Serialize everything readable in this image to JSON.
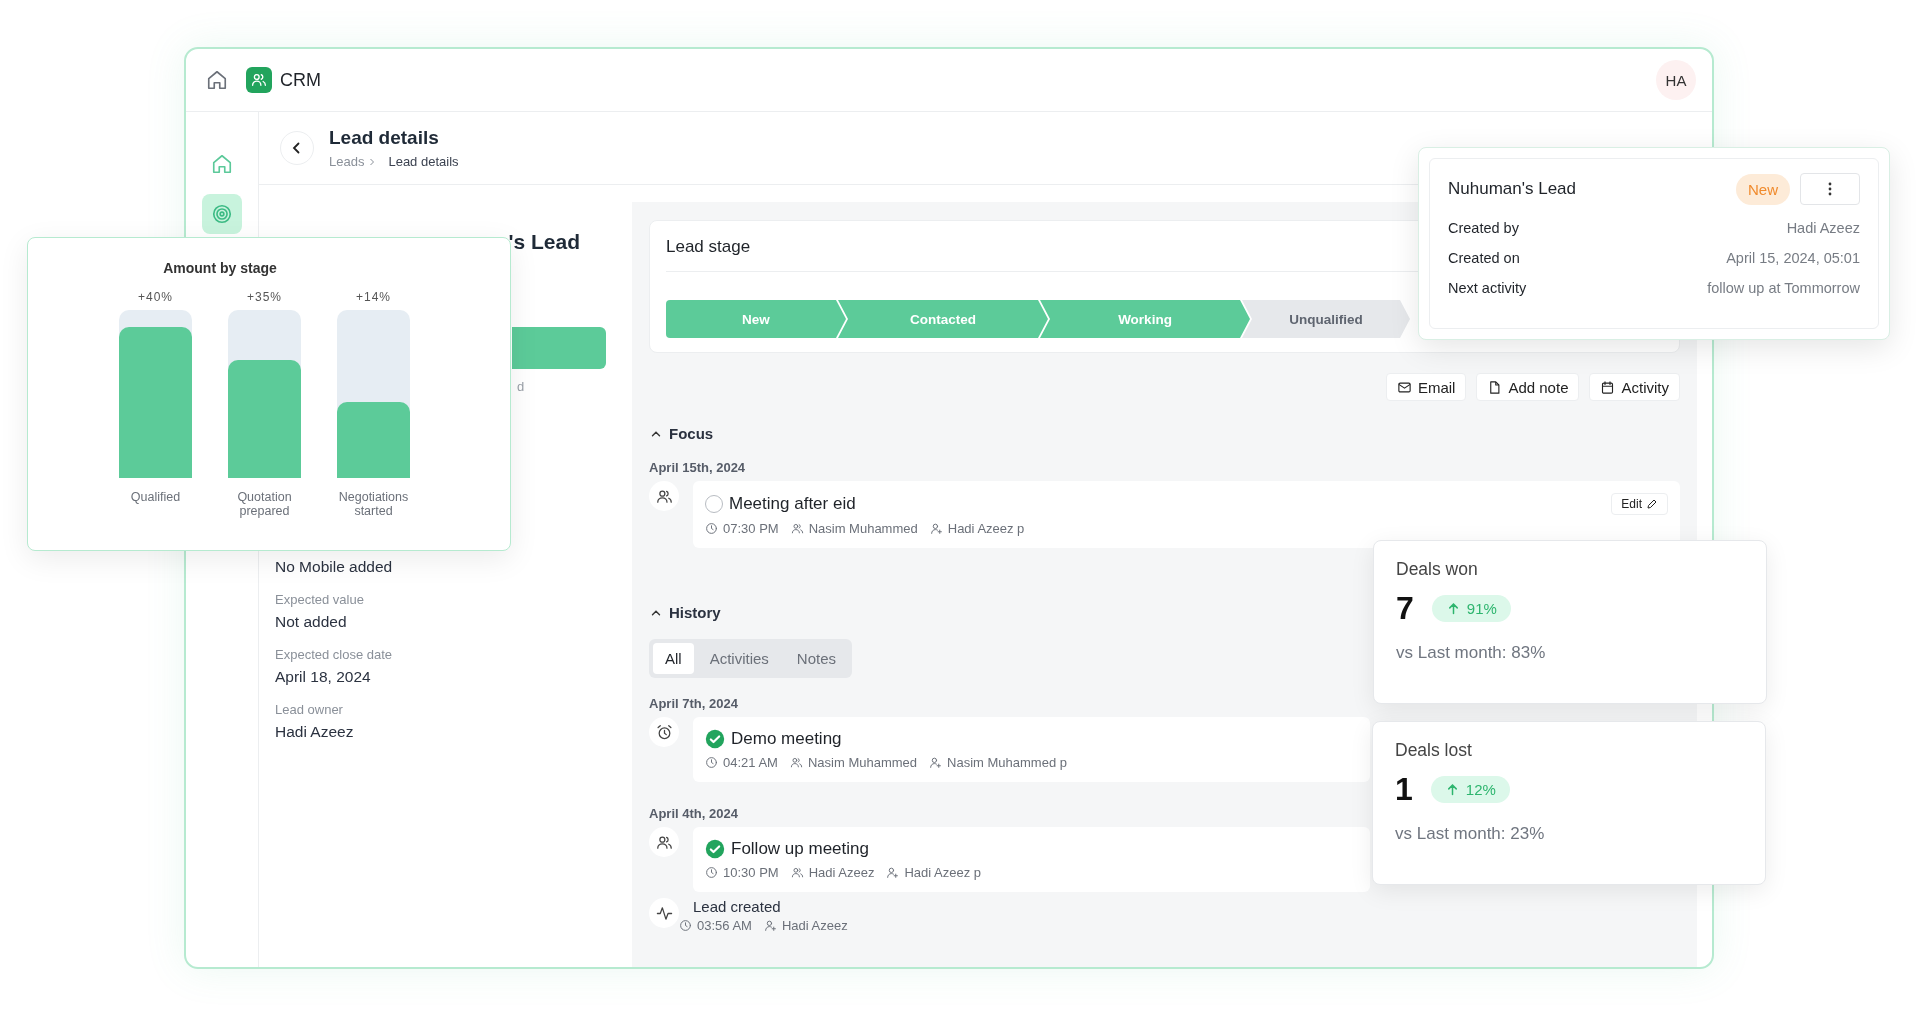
{
  "app": {
    "name": "CRM",
    "avatar": "HA"
  },
  "sidebar": {
    "items": [
      {
        "kind": "home",
        "selected": false
      },
      {
        "kind": "leads",
        "selected": true
      }
    ]
  },
  "page": {
    "title": "Lead details",
    "breadcrumb": [
      "Leads",
      "Lead details"
    ]
  },
  "lead_panel": {
    "heading": "'s Lead",
    "fragment": "d",
    "fields": [
      {
        "value": "No Mobile added"
      },
      {
        "label": "Expected value",
        "value": "Not added"
      },
      {
        "label": "Expected close date",
        "value": "April 18, 2024"
      },
      {
        "label": "Lead owner",
        "value": "Hadi Azeez"
      }
    ]
  },
  "lead_stage": {
    "title": "Lead stage",
    "stages": [
      {
        "label": "New",
        "done": true
      },
      {
        "label": "Contacted",
        "done": true
      },
      {
        "label": "Working",
        "done": true
      },
      {
        "label": "Unqualified",
        "done": false
      }
    ]
  },
  "actions": [
    {
      "kind": "email",
      "label": "Email"
    },
    {
      "kind": "note",
      "label": "Add note"
    },
    {
      "kind": "calendar",
      "label": "Activity"
    }
  ],
  "focus": {
    "title": "Focus",
    "expanded": true,
    "groups": [
      {
        "date": "April 15th, 2024",
        "items": [
          {
            "kind": "meeting",
            "title": "Meeting after eid",
            "done": false,
            "time": "07:30 PM",
            "attendee": "Nasim Muhammed",
            "owner": "Hadi Azeez p",
            "edit": "Edit"
          }
        ]
      }
    ]
  },
  "history": {
    "title": "History",
    "expanded": true,
    "tabs": [
      {
        "label": "All",
        "selected": true
      },
      {
        "label": "Activities",
        "selected": false
      },
      {
        "label": "Notes",
        "selected": false
      }
    ],
    "groups": [
      {
        "date": "April 7th, 2024",
        "items": [
          {
            "kind": "reminder",
            "title": "Demo meeting",
            "done": true,
            "time": "04:21 AM",
            "attendee": "Nasim Muhammed",
            "owner": "Nasim Muhammed p"
          }
        ]
      },
      {
        "date": "April 4th, 2024",
        "items": [
          {
            "kind": "meeting",
            "title": "Follow up meeting",
            "done": true,
            "time": "10:30 PM",
            "attendee": "Hadi Azeez",
            "owner": "Hadi Azeez p"
          },
          {
            "kind": "created",
            "title": "Lead created",
            "time": "03:56 AM",
            "owner": "Hadi Azeez"
          }
        ]
      }
    ]
  },
  "stage_chart": {
    "title": "Amount by stage",
    "bars": [
      {
        "label": "Qualified",
        "change": "+40%",
        "level": 0.9
      },
      {
        "label": "Quotation prepared",
        "change": "+35%",
        "level": 0.7
      },
      {
        "label": "Negotiations started",
        "change": "+14%",
        "level": 0.45
      }
    ]
  },
  "lead_card": {
    "title": "Nuhuman's Lead",
    "status": "New",
    "rows": [
      {
        "label": "Created by",
        "value": "Hadi Azeez"
      },
      {
        "label": "Created on",
        "value": "April 15, 2024, 05:01"
      },
      {
        "label": "Next activity",
        "value": "follow up at Tommorrow"
      }
    ]
  },
  "stat_cards": [
    {
      "title": "Deals won",
      "value": "7",
      "change": "91%",
      "comparison": "vs Last month: 83%"
    },
    {
      "title": "Deals lost",
      "value": "1",
      "change": "12%",
      "comparison": "vs Last month: 23%"
    }
  ]
}
